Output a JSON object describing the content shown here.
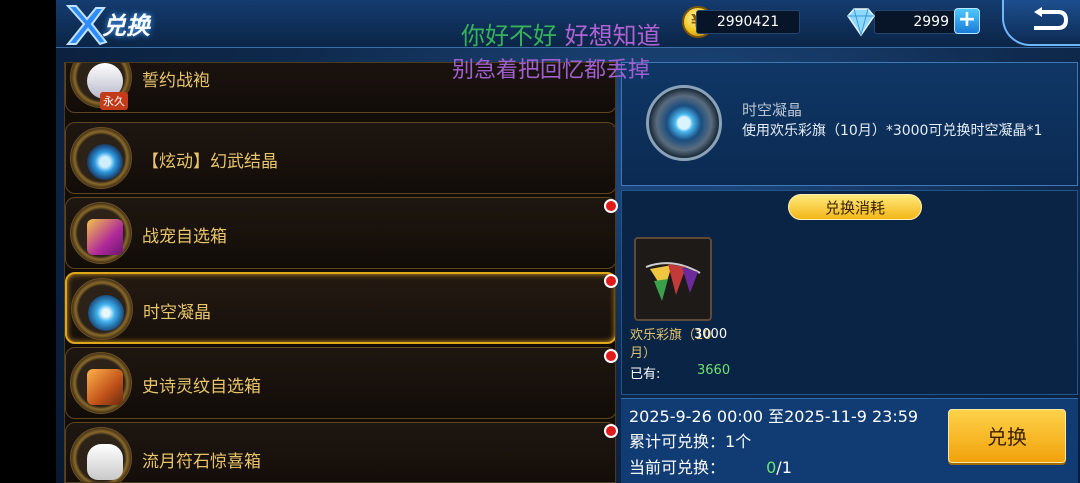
{
  "header": {
    "title": "兑换",
    "coins": "2990421",
    "gems": "2999",
    "plus": "+"
  },
  "overlay": {
    "line1_a": "你好不好",
    "line1_b": "好想知道",
    "line2": "别急着把回忆都丢掉"
  },
  "list": {
    "items": [
      {
        "name": "誓约战袍",
        "badge": "永久",
        "dot": false
      },
      {
        "name": "【炫动】幻武结晶",
        "dot": false
      },
      {
        "name": "战宠自选箱",
        "dot": true
      },
      {
        "name": "时空凝晶",
        "dot": true,
        "selected": true
      },
      {
        "name": "史诗灵纹自选箱",
        "dot": true
      },
      {
        "name": "流月符石惊喜箱",
        "dot": true
      }
    ]
  },
  "detail": {
    "name": "时空凝晶",
    "description": "使用欢乐彩旗（10月）*3000可兑换时空凝晶*1"
  },
  "cost": {
    "header": "兑换消耗",
    "item_name": "欢乐彩旗（10月）",
    "item_qty": "3000",
    "have_label": "已有:",
    "have_value": "3660"
  },
  "info": {
    "period": "2025-9-26 00:00 至2025-11-9 23:59",
    "total_label": "累计可兑换：",
    "total_value": "1个",
    "current_label": "当前可兑换：",
    "current_value": "0",
    "current_max": "/1",
    "exchange_button": "兑换"
  },
  "colors": {
    "accent_gold": "#e0a71c",
    "panel_blue": "#0f3766",
    "green": "#6de26d"
  }
}
